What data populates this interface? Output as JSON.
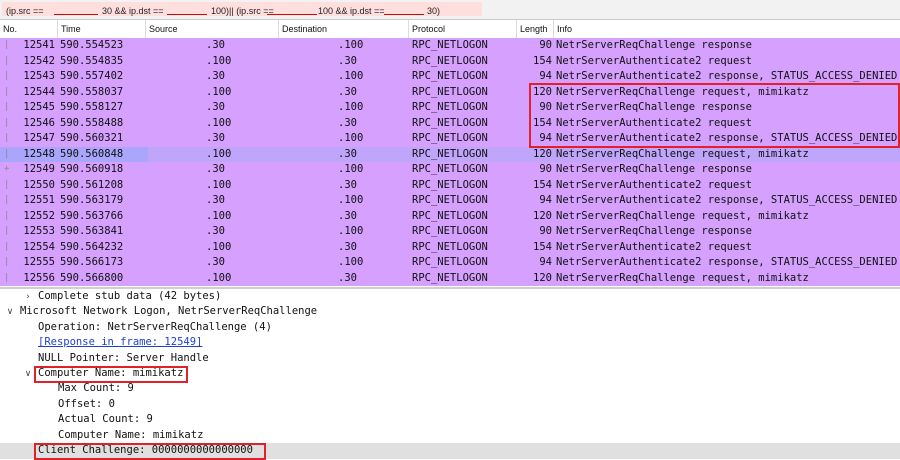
{
  "filter": {
    "segments": [
      "(ip.src ==",
      "30 && ip.dst ==",
      "100)|| (ip.src ==",
      "100 && ip.dst ==",
      "30)"
    ]
  },
  "columns": [
    "No.",
    "Time",
    "Source",
    "Destination",
    "Protocol",
    "Length",
    "Info"
  ],
  "packets": [
    {
      "no": "12541",
      "time": "590.554523",
      "src": ".30",
      "dst": ".100",
      "proto": "RPC_NETLOGON",
      "len": "90",
      "info": "NetrServerReqChallenge response"
    },
    {
      "no": "12542",
      "time": "590.554835",
      "src": ".100",
      "dst": ".30",
      "proto": "RPC_NETLOGON",
      "len": "154",
      "info": "NetrServerAuthenticate2 request"
    },
    {
      "no": "12543",
      "time": "590.557402",
      "src": ".30",
      "dst": ".100",
      "proto": "RPC_NETLOGON",
      "len": "94",
      "info": "NetrServerAuthenticate2 response, STATUS_ACCESS_DENIED"
    },
    {
      "no": "12544",
      "time": "590.558037",
      "src": ".100",
      "dst": ".30",
      "proto": "RPC_NETLOGON",
      "len": "120",
      "info": "NetrServerReqChallenge request, mimikatz"
    },
    {
      "no": "12545",
      "time": "590.558127",
      "src": ".30",
      "dst": ".100",
      "proto": "RPC_NETLOGON",
      "len": "90",
      "info": "NetrServerReqChallenge response"
    },
    {
      "no": "12546",
      "time": "590.558488",
      "src": ".100",
      "dst": ".30",
      "proto": "RPC_NETLOGON",
      "len": "154",
      "info": "NetrServerAuthenticate2 request"
    },
    {
      "no": "12547",
      "time": "590.560321",
      "src": ".30",
      "dst": ".100",
      "proto": "RPC_NETLOGON",
      "len": "94",
      "info": "NetrServerAuthenticate2 response, STATUS_ACCESS_DENIED"
    },
    {
      "no": "12548",
      "time": "590.560848",
      "src": ".100",
      "dst": ".30",
      "proto": "RPC_NETLOGON",
      "len": "120",
      "info": "NetrServerReqChallenge request, mimikatz"
    },
    {
      "no": "12549",
      "time": "590.560918",
      "src": ".30",
      "dst": ".100",
      "proto": "RPC_NETLOGON",
      "len": "90",
      "info": "NetrServerReqChallenge response"
    },
    {
      "no": "12550",
      "time": "590.561208",
      "src": ".100",
      "dst": ".30",
      "proto": "RPC_NETLOGON",
      "len": "154",
      "info": "NetrServerAuthenticate2 request"
    },
    {
      "no": "12551",
      "time": "590.563179",
      "src": ".30",
      "dst": ".100",
      "proto": "RPC_NETLOGON",
      "len": "94",
      "info": "NetrServerAuthenticate2 response, STATUS_ACCESS_DENIED"
    },
    {
      "no": "12552",
      "time": "590.563766",
      "src": ".100",
      "dst": ".30",
      "proto": "RPC_NETLOGON",
      "len": "120",
      "info": "NetrServerReqChallenge request, mimikatz"
    },
    {
      "no": "12553",
      "time": "590.563841",
      "src": ".30",
      "dst": ".100",
      "proto": "RPC_NETLOGON",
      "len": "90",
      "info": "NetrServerReqChallenge response"
    },
    {
      "no": "12554",
      "time": "590.564232",
      "src": ".100",
      "dst": ".30",
      "proto": "RPC_NETLOGON",
      "len": "154",
      "info": "NetrServerAuthenticate2 request"
    },
    {
      "no": "12555",
      "time": "590.566173",
      "src": ".30",
      "dst": ".100",
      "proto": "RPC_NETLOGON",
      "len": "94",
      "info": "NetrServerAuthenticate2 response, STATUS_ACCESS_DENIED"
    },
    {
      "no": "12556",
      "time": "590.566800",
      "src": ".100",
      "dst": ".30",
      "proto": "RPC_NETLOGON",
      "len": "120",
      "info": "NetrServerReqChallenge request, mimikatz"
    }
  ],
  "selected_packet": "12548",
  "details": [
    {
      "text": "Complete stub data (42 bytes)",
      "arrow": ">",
      "indent": 1
    },
    {
      "text": "Microsoft Network Logon, NetrServerReqChallenge",
      "arrow": "v",
      "indent": 0
    },
    {
      "text": "Operation: NetrServerReqChallenge (4)",
      "arrow": "",
      "indent": 2
    },
    {
      "text": "[Response in frame: 12549]",
      "arrow": "",
      "indent": 2,
      "link": true
    },
    {
      "text": "NULL Pointer: Server Handle",
      "arrow": "",
      "indent": 2
    },
    {
      "text": "Computer Name: mimikatz",
      "arrow": "v",
      "indent": 1
    },
    {
      "text": "Max Count: 9",
      "arrow": "",
      "indent": 3
    },
    {
      "text": "Offset: 0",
      "arrow": "",
      "indent": 3
    },
    {
      "text": "Actual Count: 9",
      "arrow": "",
      "indent": 3
    },
    {
      "text": "Computer Name: mimikatz",
      "arrow": "",
      "indent": 3
    },
    {
      "text": "Client Challenge: 0000000000000000",
      "arrow": "",
      "indent": 2,
      "highlight": true
    }
  ],
  "colors": {
    "row_bg": "#d6a1fe",
    "selected_bg": "#aaa6fb",
    "annotation_red": "#e0202a",
    "filter_bg": "#ffdede"
  },
  "icons": {
    "expand": "chevron-right-icon",
    "collapse": "chevron-down-icon"
  }
}
